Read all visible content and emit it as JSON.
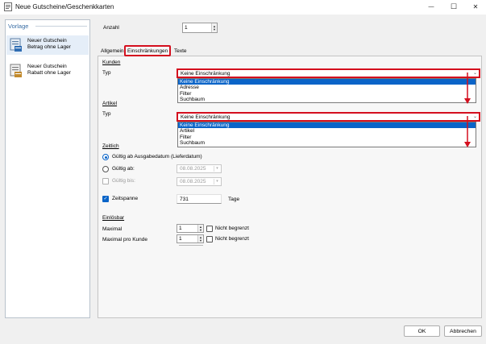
{
  "window": {
    "title": "Neue Gutscheine/Geschenkkarten",
    "minimize_glyph": "—",
    "maximize_glyph": "☐",
    "close_glyph": "✕"
  },
  "sidebar": {
    "title": "Vorlage",
    "items": [
      {
        "line1": "Neuer Gutschein",
        "line2": "Betrag ohne Lager",
        "icon": "voucher-amount-icon",
        "selected": true
      },
      {
        "line1": "Neuer Gutschein",
        "line2": "Rabatt ohne Lager",
        "icon": "voucher-discount-icon",
        "selected": false
      }
    ]
  },
  "anzahl": {
    "label": "Anzahl",
    "value": "1"
  },
  "tabs": [
    {
      "label": "Allgemein",
      "active": false
    },
    {
      "label": "Einschränkungen",
      "active": true
    },
    {
      "label": "Texte",
      "active": false
    }
  ],
  "kunden": {
    "section": "Kunden",
    "typ_label": "Typ",
    "selected": "Keine Einschränkung",
    "options": [
      "Keine Einschränkung",
      "Adresse",
      "Filter",
      "Suchbaum"
    ]
  },
  "artikel": {
    "section": "Artikel",
    "typ_label": "Typ",
    "selected": "Keine Einschränkung",
    "options": [
      "Keine Einschränkung",
      "Artikel",
      "Filter",
      "Suchbaum"
    ]
  },
  "zeitlich": {
    "section": "Zeitlich",
    "radio1": "Gültig ab Ausgabedatum (Lieferdatum)",
    "radio2": "Gültig ab:",
    "gueltig_ab_value": "08.08.2025",
    "check_bis": "Gültig bis:",
    "gueltig_bis_value": "08.08.2025",
    "zeitspanne_label": "Zeitspanne",
    "zeitspanne_value": "731",
    "zeitspanne_unit": "Tage"
  },
  "einloesbar": {
    "section": "Einlösbar",
    "maximal_label": "Maximal",
    "maximal_value": "1",
    "maximal_nb": "Nicht begrenzt",
    "prokunde_label": "Maximal pro Kunde",
    "prokunde_value": "1",
    "prokunde_nb": "Nicht begrenzt"
  },
  "buttons": {
    "ok": "OK",
    "cancel": "Abbrechen"
  },
  "colors": {
    "highlight": "#d40f1e",
    "selection": "#0a64c8",
    "accent": "#3a6ea5"
  }
}
